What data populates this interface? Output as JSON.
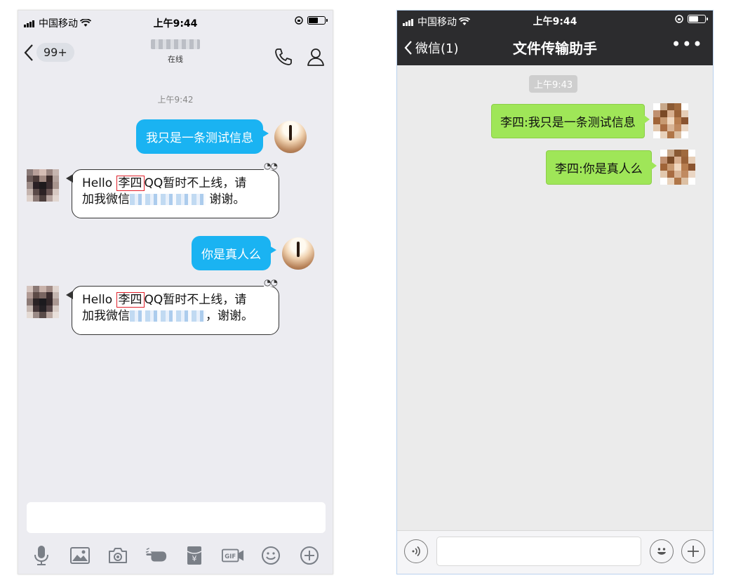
{
  "qq": {
    "status_bar": {
      "carrier": "中国移动",
      "time": "上午9:44"
    },
    "nav": {
      "back_badge": "99+",
      "contact_status": "在线"
    },
    "timestamp": "上午9:42",
    "messages": [
      {
        "side": "right",
        "text": "我只是一条测试信息"
      },
      {
        "side": "left",
        "hello": "Hello",
        "name": "李四",
        "rest1": "QQ暂时不上线，请",
        "line2a": "加我微信",
        "line2b": "谢谢。"
      },
      {
        "side": "right",
        "text": "你是真人么"
      },
      {
        "side": "left",
        "hello": "Hello",
        "name": "李四",
        "rest1": "QQ暂时不上线，请",
        "line2a": "加我微信",
        "line2b": "，谢谢。"
      }
    ],
    "toolbar": [
      "microphone-icon",
      "image-icon",
      "camera-icon",
      "poke-icon",
      "red-packet-icon",
      "gif-icon",
      "emoji-icon",
      "plus-icon"
    ]
  },
  "wechat": {
    "status_bar": {
      "carrier": "中国移动",
      "time": "上午9:44"
    },
    "nav": {
      "back_label": "微信(1)",
      "title": "文件传输助手",
      "more": "•••"
    },
    "timestamp": "上午9:43",
    "messages": [
      {
        "text": "李四:我只是一条测试信息"
      },
      {
        "text": "李四:你是真人么"
      }
    ]
  }
}
